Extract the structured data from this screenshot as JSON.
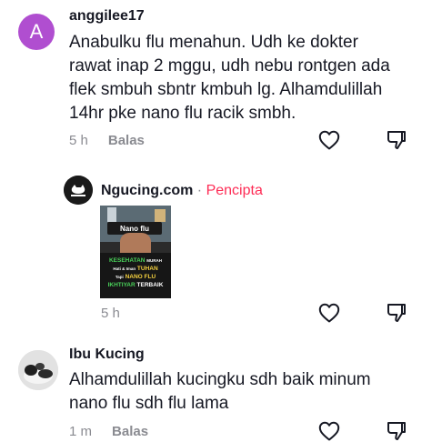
{
  "comments": [
    {
      "avatar_letter": "A",
      "username": "anggilee17",
      "lines": [
        "Anabulku flu menahun. Udh ke dokter",
        "rawat inap 2 mggu, udh nebu rontgen ada",
        "flek smbuh sbntr kmbuh lg. Alhamdulillah",
        "14hr pke nano flu racik smbh."
      ],
      "time": "5 h",
      "reply_label": "Balas"
    },
    {
      "username": "Ngucing.com",
      "separator": "·",
      "creator_label": "Pencipta",
      "time": "5 h",
      "thumbnail": {
        "badge": "Nano flu",
        "line1": "KESEHATAN",
        "line1b": "MURAH",
        "line2a": "Hati & Iman",
        "line2b": "TUHAN",
        "line3a": "Tapi",
        "line3b": "NANO FLU",
        "line4a": "IKHTIYAR",
        "line4b": "TERBAIK"
      }
    },
    {
      "username": "Ibu Kucing",
      "lines": [
        "Alhamdulillah kucingku sdh baik minum",
        "nano flu sdh flu lama"
      ],
      "time": "1 m",
      "reply_label": "Balas"
    }
  ],
  "icons": {
    "like": "heart-outline-icon",
    "dislike": "thumbs-down-outline-icon"
  },
  "colors": {
    "creator": "#fe2c55",
    "avatar_a": "#b04ed0",
    "meta": "#8a8b91"
  }
}
